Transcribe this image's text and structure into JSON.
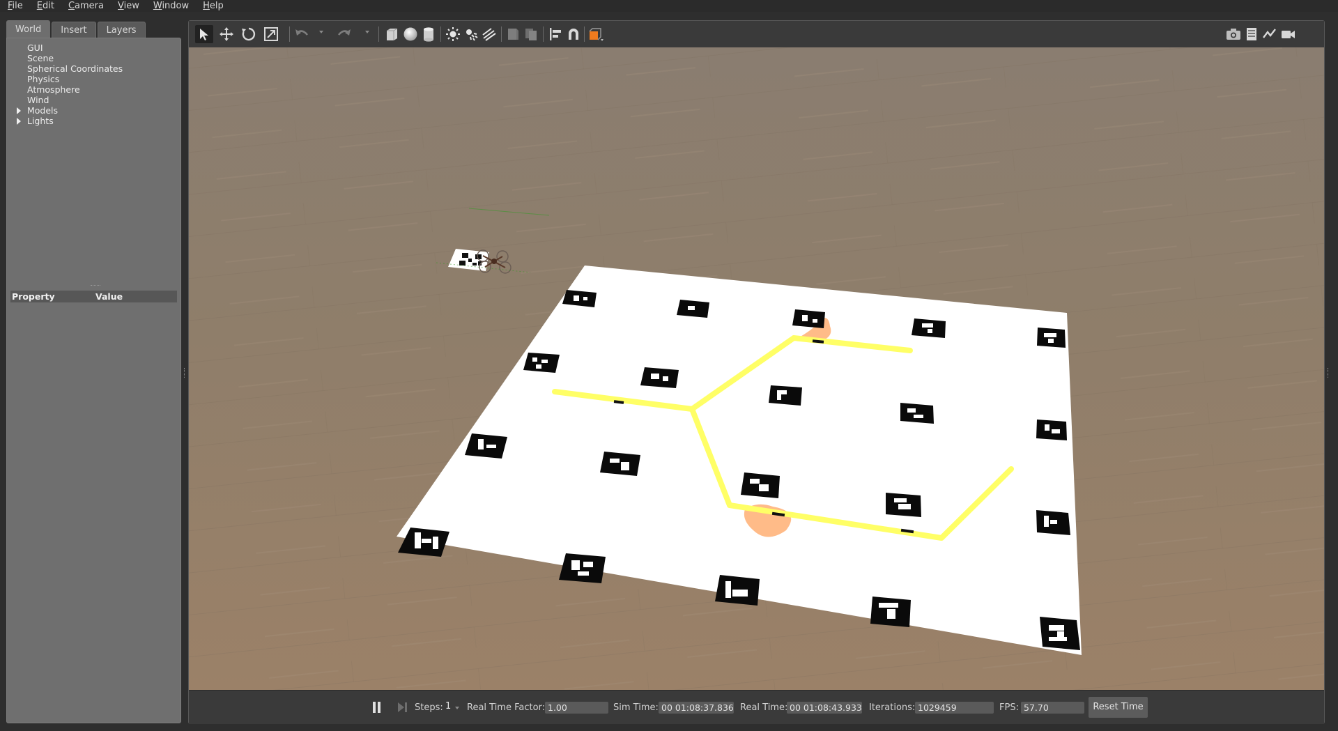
{
  "menu": {
    "items": [
      {
        "label": "File",
        "key": "F",
        "rest": "ile"
      },
      {
        "label": "Edit",
        "key": "E",
        "rest": "dit"
      },
      {
        "label": "Camera",
        "key": "C",
        "rest": "amera"
      },
      {
        "label": "View",
        "key": "V",
        "rest": "iew"
      },
      {
        "label": "Window",
        "key": "W",
        "rest": "indow"
      },
      {
        "label": "Help",
        "key": "H",
        "rest": "elp"
      }
    ]
  },
  "left_panel": {
    "tabs": [
      "World",
      "Insert",
      "Layers"
    ],
    "active_tab": "World",
    "tree": [
      {
        "label": "GUI",
        "expandable": false
      },
      {
        "label": "Scene",
        "expandable": false
      },
      {
        "label": "Spherical Coordinates",
        "expandable": false
      },
      {
        "label": "Physics",
        "expandable": false
      },
      {
        "label": "Atmosphere",
        "expandable": false
      },
      {
        "label": "Wind",
        "expandable": false
      },
      {
        "label": "Models",
        "expandable": true
      },
      {
        "label": "Lights",
        "expandable": true
      }
    ],
    "property_header": {
      "property": "Property",
      "value": "Value"
    }
  },
  "toolbar": {
    "tools": [
      "select-arrow-icon",
      "translate-icon",
      "rotate-icon",
      "scale-icon",
      "undo-icon",
      "redo-icon",
      "box-shape-icon",
      "sphere-shape-icon",
      "cylinder-shape-icon",
      "point-light-icon",
      "spot-light-icon",
      "directional-light-icon",
      "copy-icon",
      "paste-icon",
      "align-icon",
      "snap-magnet-icon",
      "view-angle-icon"
    ],
    "right_tools": [
      "screenshot-camera-icon",
      "log-record-icon",
      "plot-icon",
      "video-record-icon"
    ],
    "accent_color": "#f07b1e"
  },
  "bottombar": {
    "steps_label": "Steps:",
    "steps_value": "1",
    "real_time_factor_label": "Real Time Factor:",
    "real_time_factor_value": "1.00",
    "sim_time_label": "Sim Time:",
    "sim_time_value": "00 01:08:37.836",
    "real_time_label": "Real Time:",
    "real_time_value": "00 01:08:43.933",
    "iterations_label": "Iterations:",
    "iterations_value": "1029459",
    "fps_label": "FPS:",
    "fps_value": "57.70",
    "reset_label": "Reset Time"
  },
  "scene": {
    "floor_color": "#8c7a66",
    "mat_color": "#ffffff",
    "path_color": "#ffff66",
    "blob_color": "#ffbb88",
    "marker_color": "#000000"
  }
}
